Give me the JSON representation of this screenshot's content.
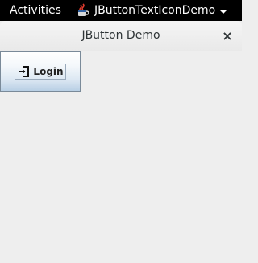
{
  "topbar": {
    "activities_label": "Activities",
    "app_name": "JButtonTextIconDemo",
    "app_icon": "java-cup-icon",
    "menu_icon": "caret-down-icon"
  },
  "window": {
    "title": "JButton Demo",
    "close_icon": "close-icon",
    "close_glyph": "×"
  },
  "content": {
    "login_button": {
      "label": "Login",
      "icon": "login-arrow-icon"
    }
  },
  "colors": {
    "topbar_bg": "#000000",
    "window_bg": "#eeeeee",
    "button_gradient_top": "#ffffff",
    "button_gradient_bottom": "#b8cfe5",
    "button_border": "#7a8a99"
  }
}
